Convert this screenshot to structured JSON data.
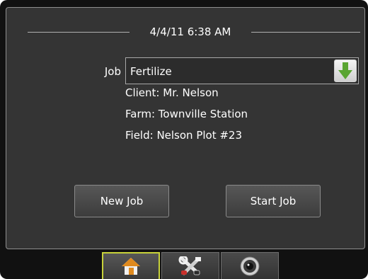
{
  "header": {
    "datetime": "4/4/11 6:38 AM"
  },
  "job": {
    "label": "Job",
    "selected": "Fertilize",
    "client": "Client: Mr. Nelson",
    "farm": "Farm: Townville Station",
    "field": "Field: Nelson Plot #23"
  },
  "buttons": {
    "new_job": "New Job",
    "start_job": "Start Job"
  },
  "tabs": [
    {
      "icon": "home-icon",
      "active": true
    },
    {
      "icon": "tools-icon",
      "active": false
    },
    {
      "icon": "camera-icon",
      "active": false
    }
  ],
  "colors": {
    "screen_bg": "#343434",
    "active_tab_border": "#c8d23a",
    "dropdown_arrow": "#5aa532"
  }
}
